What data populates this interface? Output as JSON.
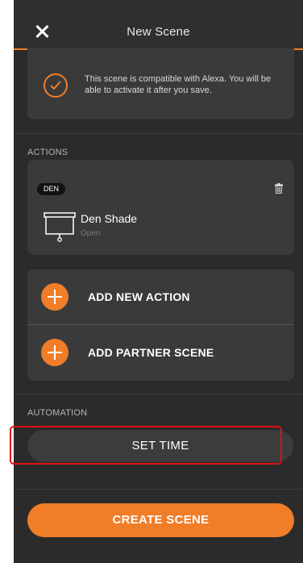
{
  "header": {
    "title": "New Scene",
    "close_icon": "close-icon"
  },
  "alexa_notice": {
    "icon": "check-circle-icon",
    "text": "This scene is compatible with Alexa. You will be able to activate it after you save."
  },
  "actions": {
    "section_label": "ACTIONS",
    "items": [
      {
        "room": "DEN",
        "name": "Den Shade",
        "state": "Open",
        "icon": "shade-icon",
        "delete_icon": "trash-icon"
      }
    ],
    "add_new_action_label": "ADD NEW ACTION",
    "add_partner_scene_label": "ADD PARTNER SCENE"
  },
  "automation": {
    "section_label": "AUTOMATION",
    "set_time_label": "SET TIME"
  },
  "footer": {
    "create_label": "CREATE SCENE"
  },
  "colors": {
    "accent": "#f07d28",
    "background": "#2b2b2b",
    "card": "#3a3a3a",
    "highlight": "#e01010"
  }
}
